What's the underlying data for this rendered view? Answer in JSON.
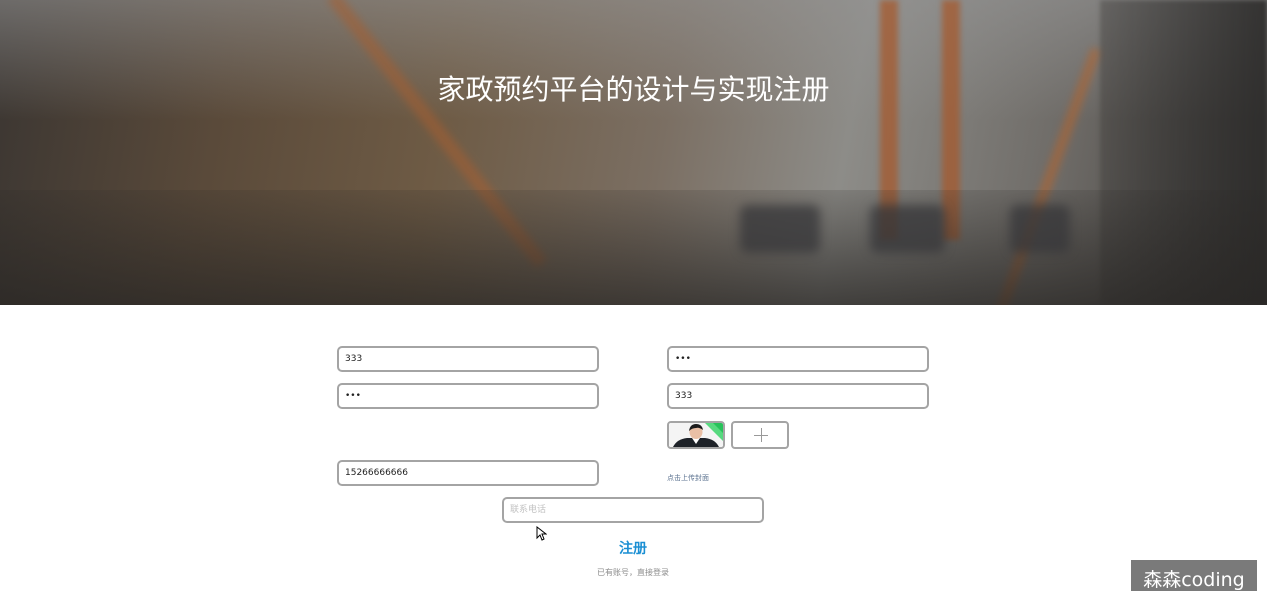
{
  "page": {
    "title": "家政预约平台的设计与实现注册"
  },
  "form": {
    "username_value": "333",
    "password_value": "•••",
    "confirm_password_value": "•••",
    "name_value": "333",
    "phone_value": "15266666666",
    "company_phone_placeholder": "联系电话",
    "upload_hint": "点击上传封面"
  },
  "actions": {
    "register_label": "注册",
    "login_link_label": "已有账号，直接登录"
  },
  "watermark": {
    "text": "森森coding"
  },
  "colors": {
    "accent": "#1b8fd3",
    "field_border": "#a4a4a4"
  }
}
